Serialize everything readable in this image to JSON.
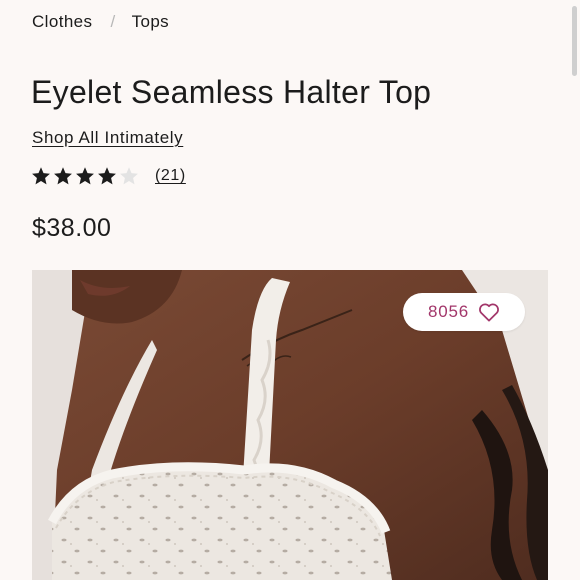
{
  "breadcrumb": {
    "items": [
      "Clothes",
      "Tops"
    ],
    "separator": "/"
  },
  "product": {
    "title": "Eyelet Seamless Halter Top",
    "brand_link": "Shop All Intimately",
    "rating": {
      "stars": 4.5,
      "max": 5,
      "review_count": "(21)"
    },
    "price": "$38.00"
  },
  "photo": {
    "alt_subject": "model wearing white lace halter top",
    "likes": "8056",
    "like_icon": "heart-outline-icon"
  },
  "colors": {
    "accent": "#a2366a",
    "text": "#1c1c1c",
    "background": "#fcf8f6"
  }
}
